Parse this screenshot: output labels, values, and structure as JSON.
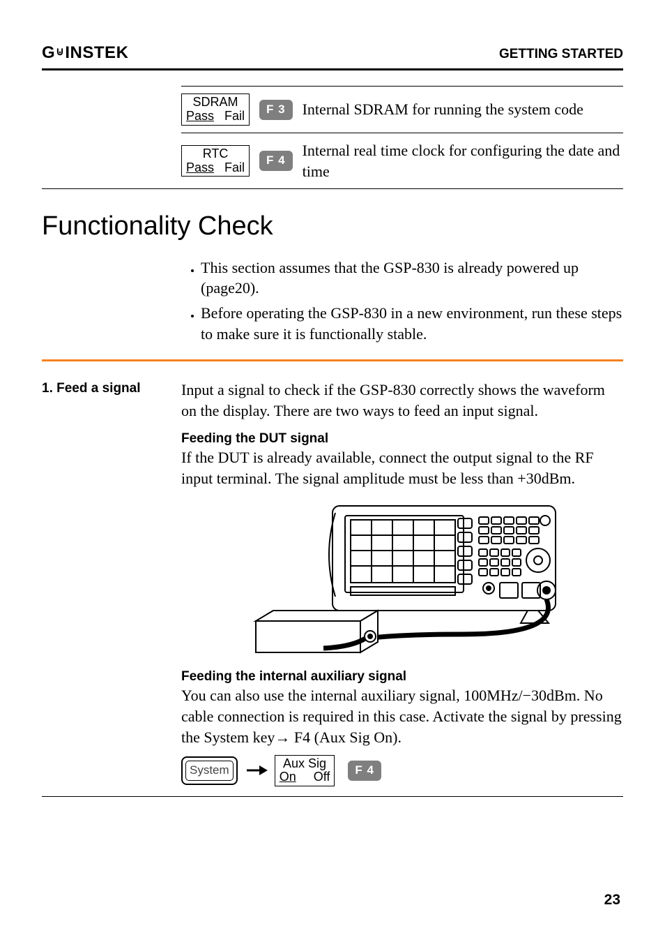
{
  "header": {
    "brand_full": "GWINSTEK",
    "section": "GETTING STARTED"
  },
  "top_table": [
    {
      "lcd_line1": "SDRAM",
      "lcd_line2_underlined": "Pass",
      "lcd_line2_rest": "   Fail",
      "fkey": "F 3",
      "desc": "Internal SDRAM for running the system code"
    },
    {
      "lcd_line1": "RTC",
      "lcd_line2_underlined": "Pass",
      "lcd_line2_rest": "   Fail",
      "fkey": "F 4",
      "desc": "Internal real time clock for configuring the date and time"
    }
  ],
  "section_title": "Functionality Check",
  "bullets": [
    "This section assumes that the GSP-830 is already powered up (page20).",
    "Before operating the GSP-830 in a new environment, run these steps to make sure it is functionally stable."
  ],
  "step1": {
    "heading": "1. Feed a signal",
    "intro": "Input a signal to check if the GSP-830 correctly shows the waveform on the display. There are two ways to feed an input signal.",
    "sub1_head": "Feeding the DUT signal",
    "sub1_body": "If the DUT is already available, connect the output signal to the RF input terminal. The signal amplitude must be less than +30dBm.",
    "sub2_head": "Feeding the internal auxiliary signal",
    "sub2_body": "You can also use the internal auxiliary signal, 100MHz/−30dBm. No cable connection is required in this case. Activate the signal by pressing the System key→ F4 (Aux Sig On).",
    "system_key": "System",
    "aux_lcd_line1": "Aux Sig",
    "aux_lcd_line2_underlined": "On",
    "aux_lcd_line2_rest": "     Off",
    "aux_fkey": "F 4"
  },
  "page_number": "23"
}
